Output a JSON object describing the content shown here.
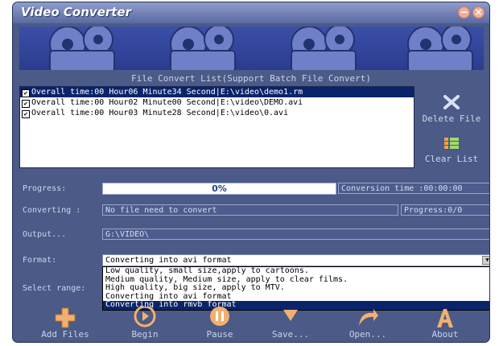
{
  "window": {
    "title": "Video Converter",
    "minimize_glyph": "−",
    "close_glyph": "×"
  },
  "file_list": {
    "heading": "File Convert List(Support Batch File Convert)",
    "rows": [
      {
        "checked": true,
        "duration": "Overall time:00 Hour06 Minute34 Second",
        "path": "E:\\video\\demo1.rm",
        "selected": true
      },
      {
        "checked": true,
        "duration": "Overall time:00 Hour02 Minute00 Second",
        "path": "E:\\video\\DEMO.avi",
        "selected": false
      },
      {
        "checked": true,
        "duration": "Overall time:00 Hour03 Minute28 Second",
        "path": "E:\\video\\0.avi",
        "selected": false
      }
    ]
  },
  "side_buttons": {
    "delete_label": "Delete File",
    "clear_label": "Clear List"
  },
  "progress": {
    "label": "Progress:",
    "percent_text": "0%",
    "percent": 0,
    "conversion_time": "Conversion time :00:00:00"
  },
  "converting": {
    "label": "Converting :",
    "value": "No file need to convert",
    "progress_count": "Progress:0/0"
  },
  "output": {
    "label": "Output...",
    "value": "G:\\VIDEO\\"
  },
  "format": {
    "label": "Format:",
    "selected_value": "Converting into avi format",
    "options": [
      "Low quality, small size,apply to cartoons.",
      "Medium quality, Medium size, apply to clear films.",
      "High quality, big size, apply to MTV.",
      "Converting into avi format",
      "Converting into rmvb format"
    ],
    "highlighted_index": 4
  },
  "select_range": {
    "label": "Select range:"
  },
  "toolbar": {
    "add_files": "Add Files",
    "begin": "Begin",
    "pause": "Pause",
    "save": "Save...",
    "open": "Open...",
    "about": "About"
  },
  "colors": {
    "window_bg": "#4b5a86",
    "selection": "#0a246a",
    "icon_accent": "#f0b070"
  }
}
